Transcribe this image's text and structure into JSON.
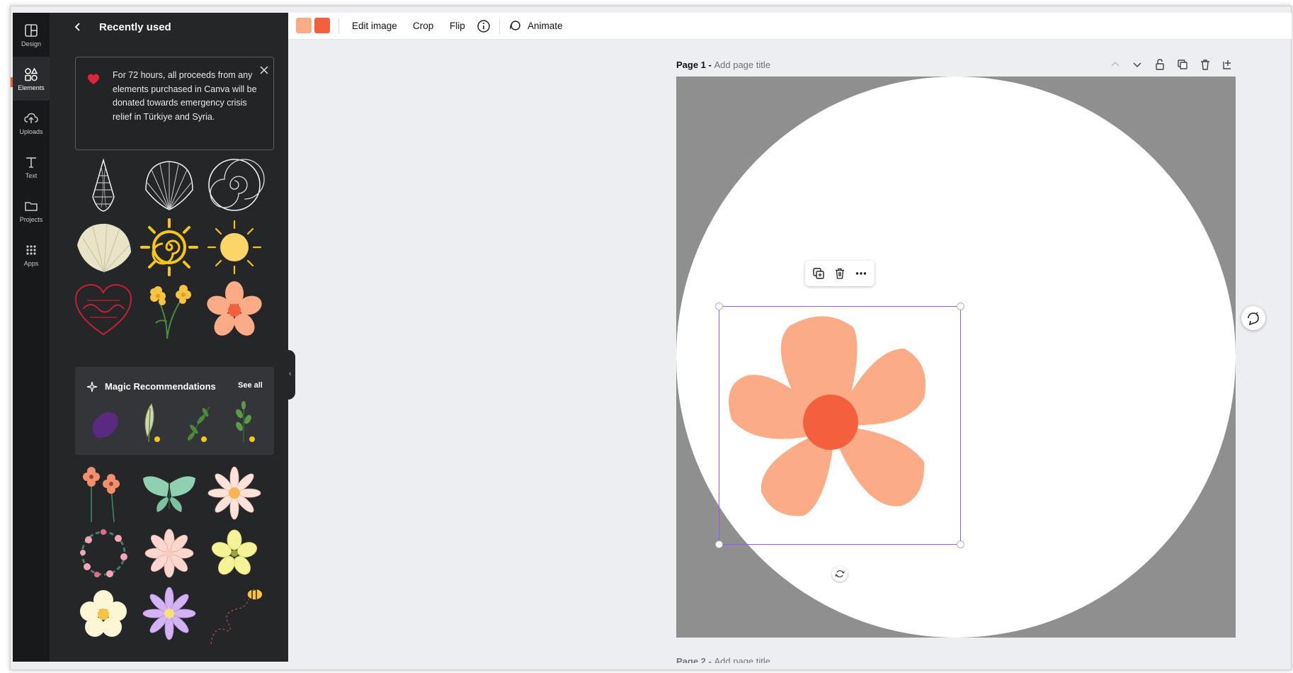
{
  "rail": {
    "items": [
      {
        "label": "Design",
        "icon": "layout-icon"
      },
      {
        "label": "Elements",
        "icon": "elements-icon"
      },
      {
        "label": "Uploads",
        "icon": "cloud-upload-icon"
      },
      {
        "label": "Text",
        "icon": "text-icon"
      },
      {
        "label": "Projects",
        "icon": "folder-icon"
      },
      {
        "label": "Apps",
        "icon": "grid-icon"
      }
    ]
  },
  "panel": {
    "title": "Recently used",
    "notice": "For 72 hours, all proceeds from any elements purchased in Canva will be donated towards emergency crisis relief in Türkiye and Syria.",
    "magic": {
      "title": "Magic Recommendations",
      "see_all": "See all"
    }
  },
  "toolbar": {
    "swatches": [
      "#fbab85",
      "#f4603e"
    ],
    "edit_image": "Edit image",
    "crop": "Crop",
    "flip": "Flip",
    "animate": "Animate"
  },
  "page": {
    "label": "Page 1 - ",
    "title_placeholder": "Add page title",
    "page2_label": "Page 2 - ",
    "page2_placeholder": "Add page title",
    "background": "#8f8f8f"
  },
  "colors": {
    "petal": "#fbab85",
    "center": "#f4603e",
    "selection": "#8b5cf6",
    "panel_bg": "#252627",
    "rail_bg": "#18191b"
  }
}
